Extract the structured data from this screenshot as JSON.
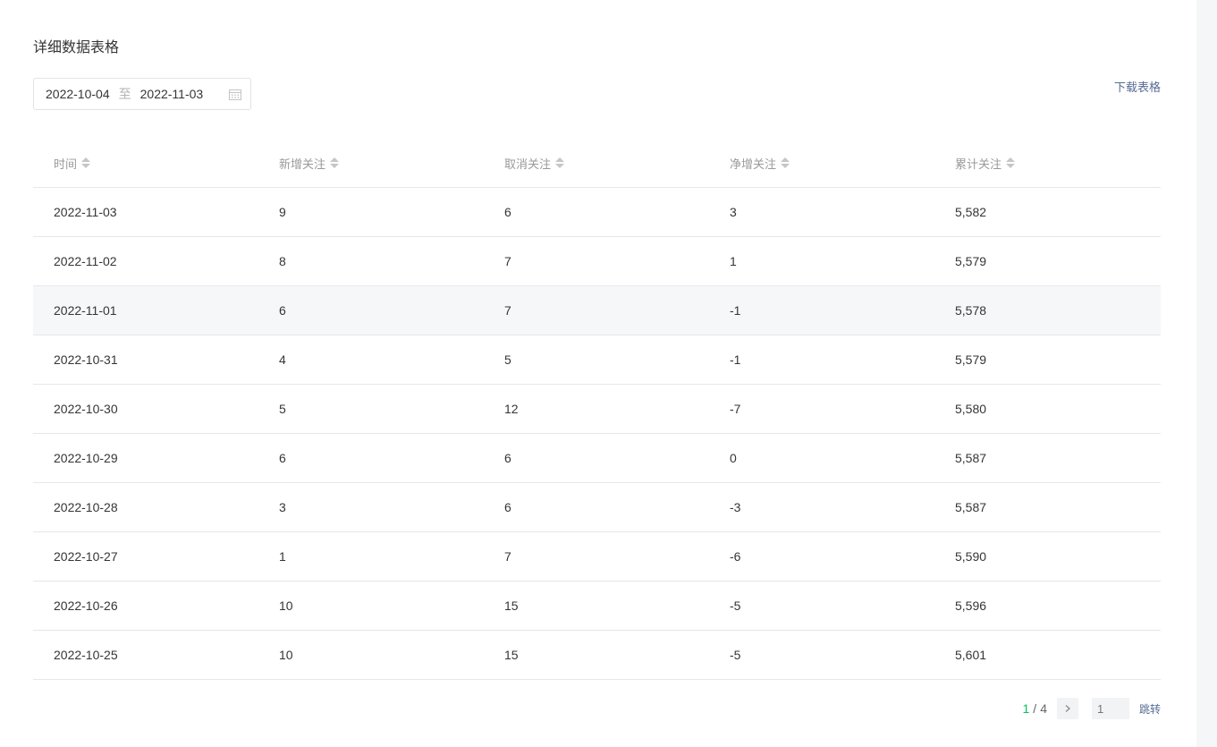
{
  "section_title": "详细数据表格",
  "date_range": {
    "start": "2022-10-04",
    "separator": "至",
    "end": "2022-11-03",
    "icon": "calendar-icon"
  },
  "download_label": "下载表格",
  "table": {
    "columns": [
      "时间",
      "新增关注",
      "取消关注",
      "净增关注",
      "累计关注"
    ],
    "sort_icon": "sort-icon",
    "rows": [
      [
        "2022-11-03",
        "9",
        "6",
        "3",
        "5,582"
      ],
      [
        "2022-11-02",
        "8",
        "7",
        "1",
        "5,579"
      ],
      [
        "2022-11-01",
        "6",
        "7",
        "-1",
        "5,578"
      ],
      [
        "2022-10-31",
        "4",
        "5",
        "-1",
        "5,579"
      ],
      [
        "2022-10-30",
        "5",
        "12",
        "-7",
        "5,580"
      ],
      [
        "2022-10-29",
        "6",
        "6",
        "0",
        "5,587"
      ],
      [
        "2022-10-28",
        "3",
        "6",
        "-3",
        "5,587"
      ],
      [
        "2022-10-27",
        "1",
        "7",
        "-6",
        "5,590"
      ],
      [
        "2022-10-26",
        "10",
        "15",
        "-5",
        "5,596"
      ],
      [
        "2022-10-25",
        "10",
        "15",
        "-5",
        "5,601"
      ]
    ],
    "hovered_row_index": 2
  },
  "pagination": {
    "current": "1",
    "separator": "/",
    "total": "4",
    "next_icon": "chevron-right-icon",
    "input_placeholder": "1",
    "jump_label": "跳转"
  },
  "colors": {
    "accent": "#07c160",
    "link": "#576b95",
    "border": "#e7e7eb",
    "hover_row": "#f6f7f9"
  }
}
